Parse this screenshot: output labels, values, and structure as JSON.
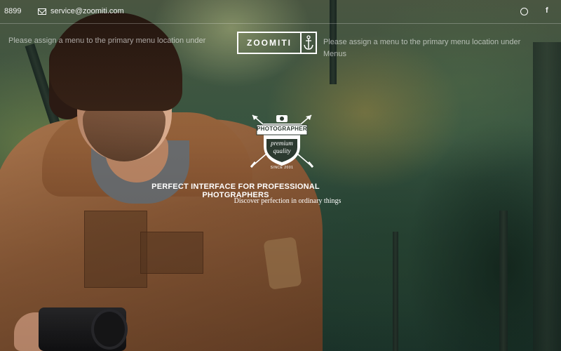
{
  "topbar": {
    "phone": "8899",
    "email": "service@zoomiti.com",
    "social": [
      "dribbble-icon",
      "facebook-icon"
    ],
    "facebook_glyph": "f"
  },
  "nav": {
    "left_placeholder": "Please assign a menu to the primary menu location under",
    "right_placeholder": "Please assign a menu to the primary menu location under Menus"
  },
  "logo": {
    "text": "ZOOMITI",
    "icon": "anchor-icon"
  },
  "badge": {
    "title": "PHOTOGRAPHER",
    "line1": "premium",
    "line2": "quality",
    "since": "SINCE 2001",
    "icon": "camera-icon"
  },
  "hero": {
    "headline": "PERFECT INTERFACE FOR PROFESSIONAL PHOTGRAPHERS",
    "subline": "Discover perfection in ordinary things"
  },
  "colors": {
    "text": "#ffffff",
    "jacket": "#8e5c38",
    "forest": "#2c4a3c"
  }
}
